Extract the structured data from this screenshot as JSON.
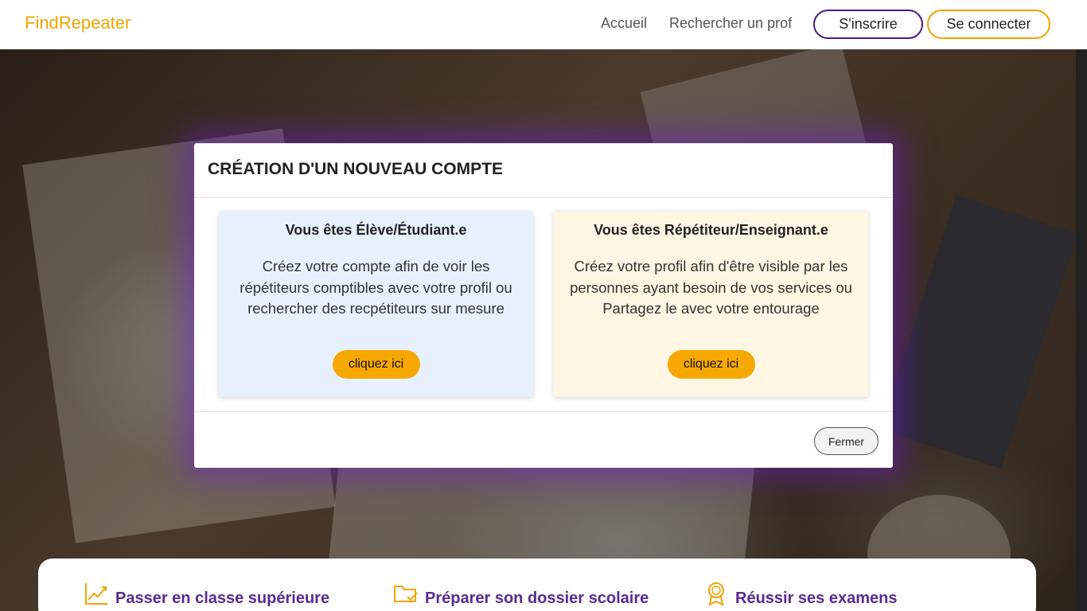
{
  "navbar": {
    "brand": "FindRepeater",
    "links": [
      "Accueil",
      "Rechercher un prof"
    ],
    "signup_label": "S'inscrire",
    "login_label": "Se connecter"
  },
  "modal": {
    "title": "CRÉATION D'UN NOUVEAU COMPTE",
    "student_card": {
      "title": "Vous êtes Élève/Étudiant.e",
      "text": "Créez votre compte afin de voir les répétiteurs comptibles avec votre profil ou rechercher des recpétiteurs sur mesure",
      "button": "cliquez ici"
    },
    "teacher_card": {
      "title": "Vous êtes Répétiteur/Enseignant.e",
      "text": "Créez votre profil afin d'être visible par les personnes ayant besoin de vos services ou Partagez le avec votre entourage",
      "button": "cliquez ici"
    },
    "close_label": "Fermer"
  },
  "features": [
    {
      "label": "Passer en classe supérieure",
      "icon": "chart-line-icon"
    },
    {
      "label": "Préparer son dossier scolaire",
      "icon": "folder-check-icon"
    },
    {
      "label": "Réussir ses examens",
      "icon": "award-icon"
    }
  ],
  "colors": {
    "brand": "#f0a500",
    "accent_purple": "#4b1a87",
    "button_orange": "#f7a800",
    "feature_text": "#5a2a91",
    "student_card_bg": "#e6f1fd",
    "teacher_card_bg": "#fff6e3"
  }
}
